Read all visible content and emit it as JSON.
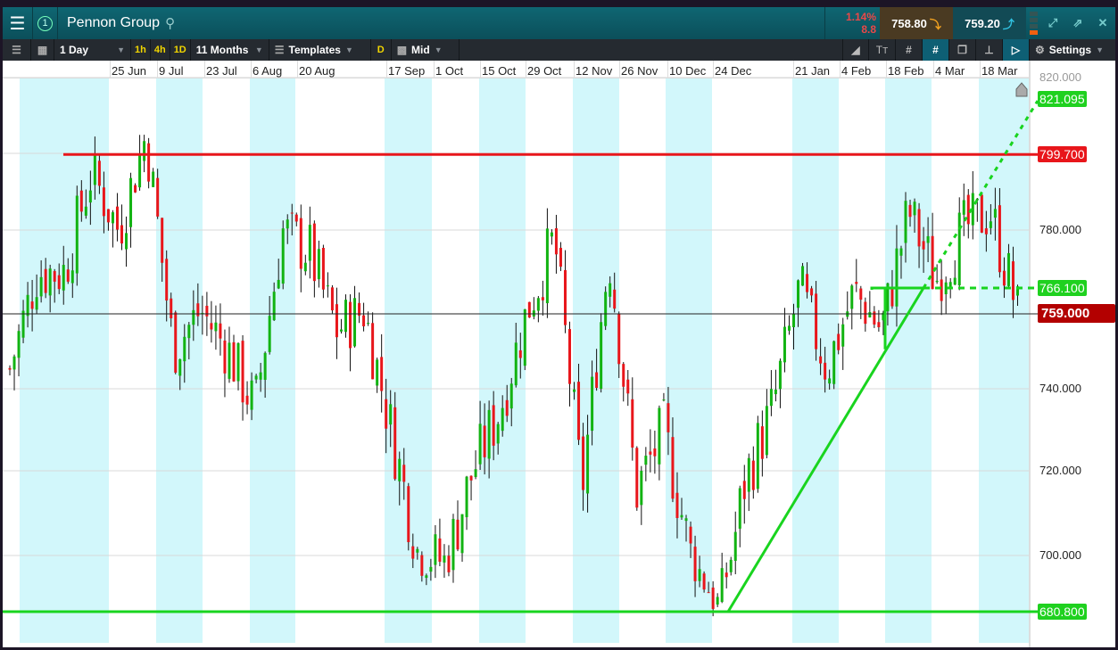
{
  "header": {
    "instrument": "Pennon Group",
    "layout_number": "1",
    "change_pct": "1.14%",
    "change_abs": "8.8",
    "sell": "758.80",
    "buy": "759.20"
  },
  "toolbar": {
    "interval": "1 Day",
    "quick_1h": "1h",
    "quick_4h": "4h",
    "quick_1d": "1D",
    "range": "11 Months",
    "templates": "Templates",
    "d_badge": "D",
    "price_type": "Mid",
    "settings": "Settings"
  },
  "colors": {
    "up": "#12b312",
    "down": "#e8161b",
    "support": "#19d41f",
    "resistance": "#e8161b",
    "weekend": "#d2f7fb"
  },
  "chart_data": {
    "type": "candlestick",
    "date_labels": [
      "25 Jun",
      "9 Jul",
      "23 Jul",
      "6 Aug",
      "20 Aug",
      "17 Sep",
      "1 Oct",
      "15 Oct",
      "29 Oct",
      "12 Nov",
      "26 Nov",
      "10 Dec",
      "24 Dec",
      "21 Jan",
      "4 Feb",
      "18 Feb",
      "4 Mar",
      "18 Mar"
    ],
    "price_ticks": [
      "820.000",
      "800.000",
      "780.000",
      "740.000",
      "720.000",
      "700.000"
    ],
    "price_tick_values": [
      820,
      800,
      780,
      740,
      720,
      700
    ],
    "levels": {
      "resistance": "799.700",
      "support": "680.800",
      "current": "759.000",
      "horizontal_green": "766.100",
      "projection": "821.095"
    },
    "approx_close_path": [
      745,
      770,
      770,
      795,
      780,
      805,
      750,
      760,
      750,
      735,
      780,
      775,
      755,
      760,
      730,
      700,
      698,
      720,
      735,
      760,
      778,
      715,
      775,
      715,
      730,
      700,
      683,
      718,
      735,
      766,
      745,
      765,
      755,
      785,
      768,
      780,
      785,
      760
    ]
  }
}
